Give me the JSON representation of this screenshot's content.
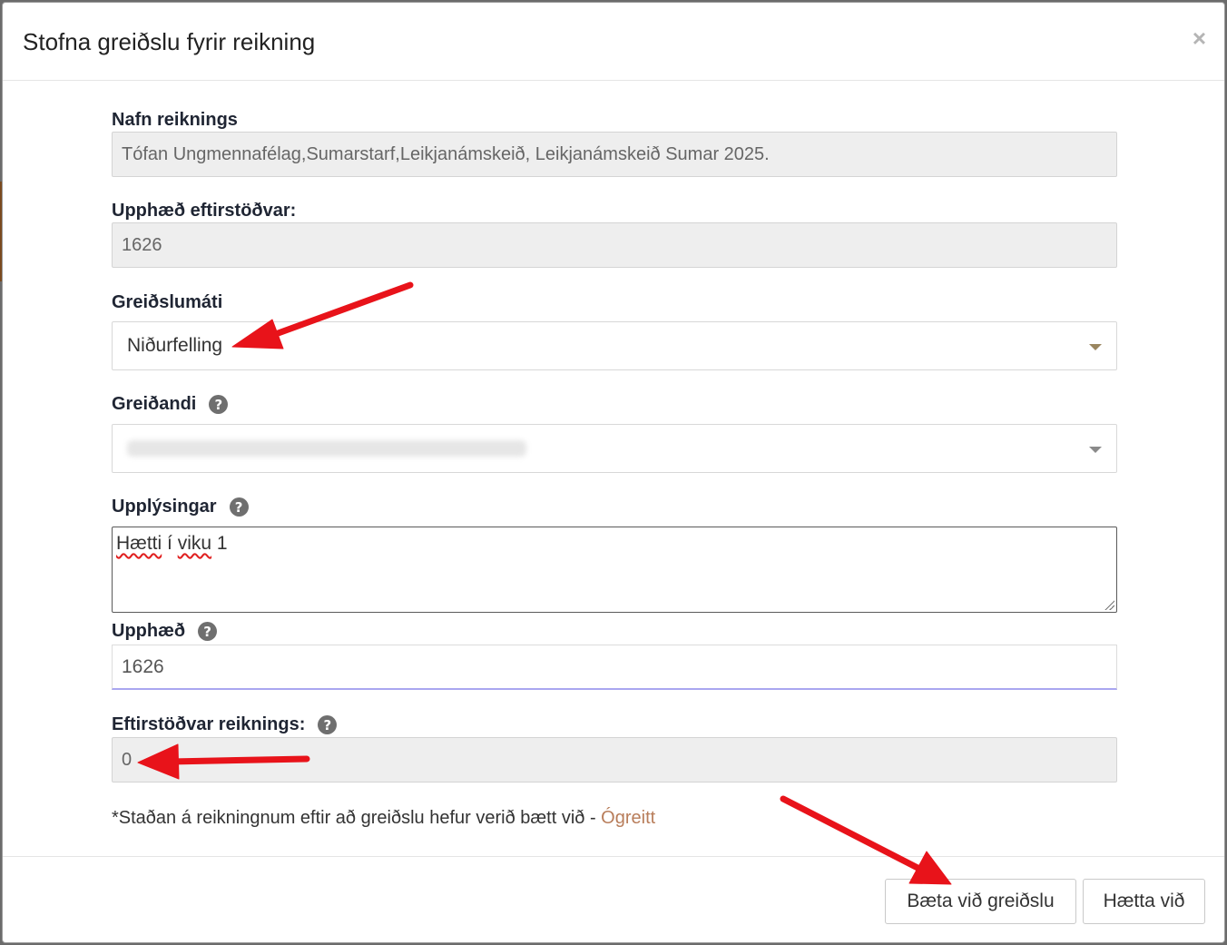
{
  "modal": {
    "title": "Stofna greiðslu fyrir reikning",
    "close_label": "×"
  },
  "fields": {
    "invoice_name": {
      "label": "Nafn reiknings",
      "value": "Tófan Ungmennafélag,Sumarstarf,Leikjanámskeið, Leikjanámskeið Sumar 2025."
    },
    "remaining_amount": {
      "label": "Upphæð eftirstöðvar:",
      "value": "1626"
    },
    "payment_method": {
      "label": "Greiðslumáti",
      "selected": "Niðurfelling"
    },
    "payer": {
      "label": "Greiðandi",
      "selected": ""
    },
    "information": {
      "label": "Upplýsingar",
      "word1": "Hætti",
      "word2": "í",
      "word3": "viku",
      "word4": "1"
    },
    "amount": {
      "label": "Upphæð",
      "value": "1626"
    },
    "invoice_balance": {
      "label": "Eftirstöðvar reiknings:",
      "value": "0"
    }
  },
  "note": {
    "text": "*Staðan á reikningnum eftir að greiðslu hefur verið bætt við - ",
    "status": "Ógreitt"
  },
  "footer": {
    "add_payment_label": "Bæta við greiðslu",
    "cancel_label": "Hætta við"
  },
  "colors": {
    "annotation_arrow": "#e8131a",
    "status_text": "#b87d5a",
    "active_input_underline": "#aaa6f0"
  },
  "icons": {
    "help": "question-circle-icon",
    "close": "close-icon",
    "dropdown": "caret-down-icon"
  }
}
